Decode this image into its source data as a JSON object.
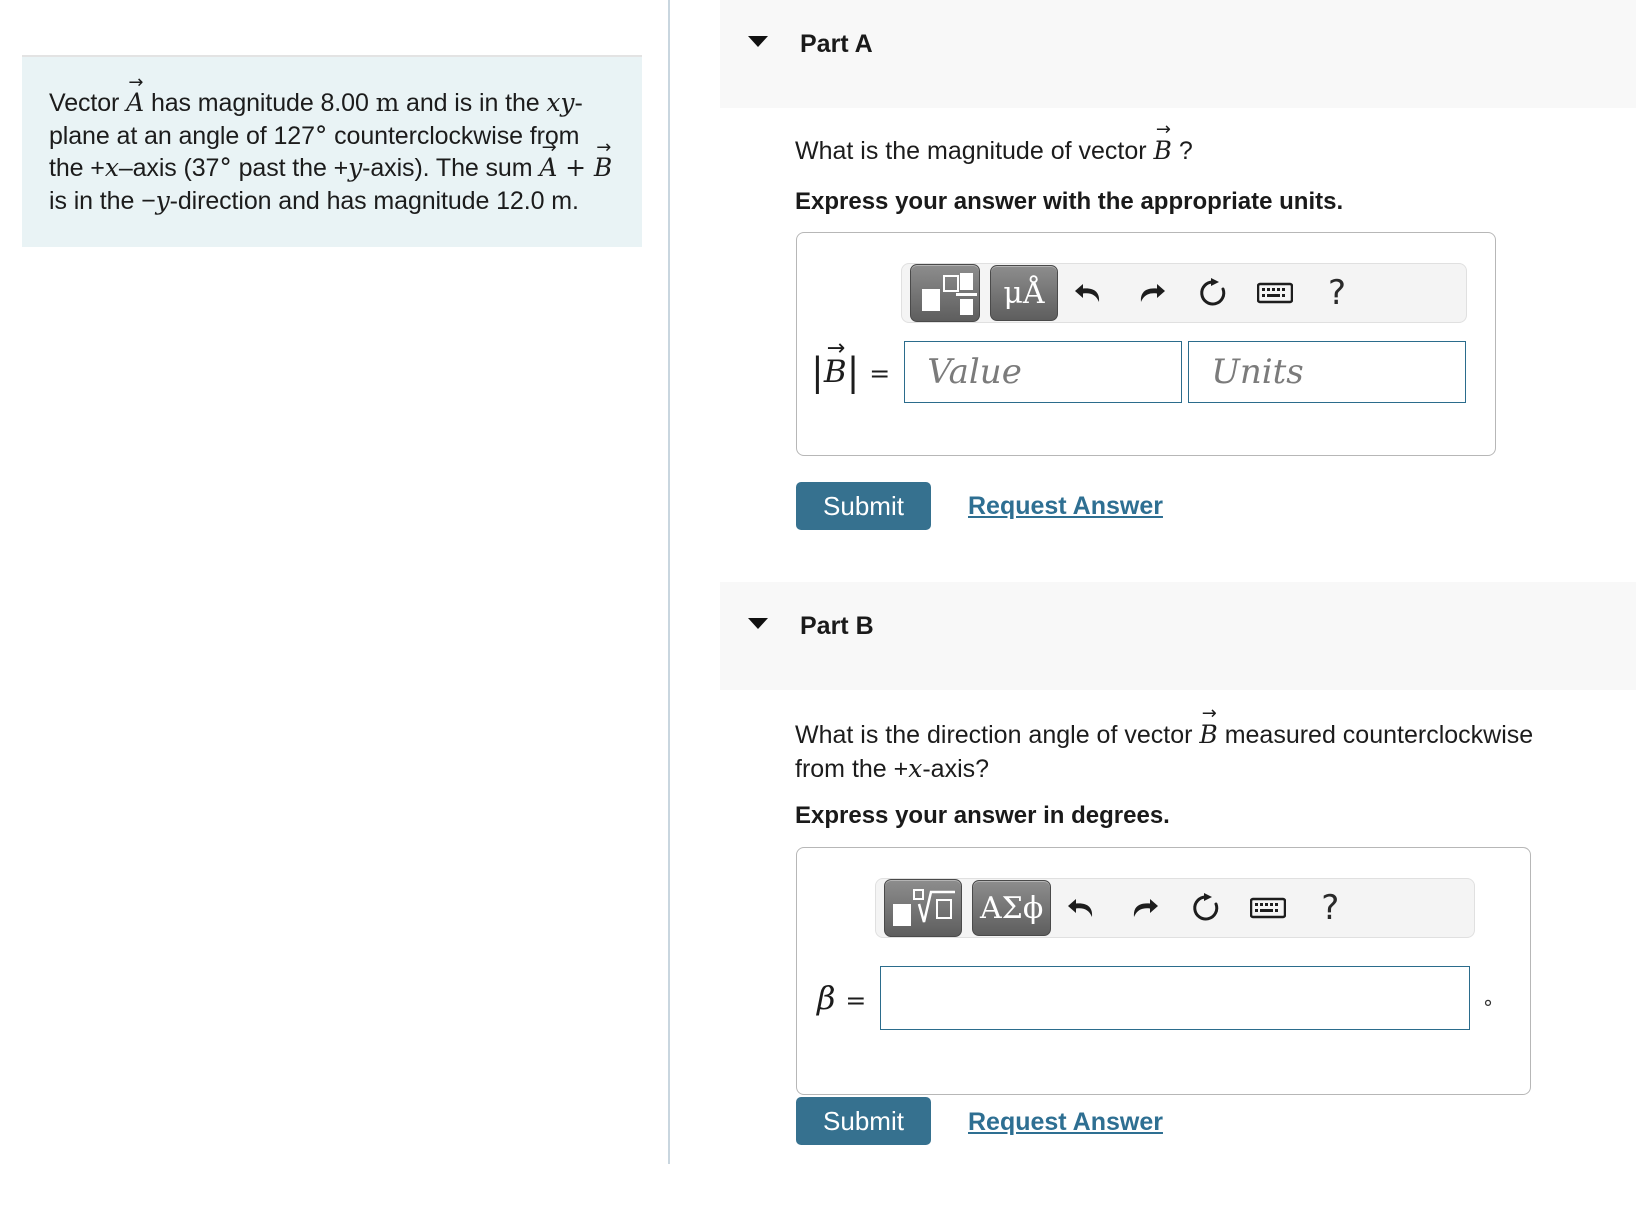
{
  "problem": {
    "line1_pre": "Vector ",
    "vec_a": "A",
    "line1_mid": " has magnitude 8.00 ",
    "unit_m": "m",
    "line1_post": " and is in the ",
    "xy": "xy",
    "line2_a": "-plane at an angle of 127",
    "deg": "°",
    "line2_b": " counterclockwise",
    "line3_a": "from the +",
    "x_sym": "x",
    "line3_b": "–axis (37",
    "line3_c": " past the +",
    "y_sym": "y",
    "line3_d": "-axis). The sum",
    "vec_b": "B",
    "line4_a": " is in the −",
    "line4_b": "-direction and has magnitude",
    "line5": "12.0 m."
  },
  "parts": [
    {
      "id": "part-a",
      "title": "Part A",
      "caret": "caret-down-icon",
      "question_pre": "What is the magnitude of vector ",
      "question_vec": "B",
      "question_post": " ?",
      "prompt": "Express your answer with the appropriate units.",
      "toolbar": {
        "template_button": "math-template-icon",
        "symbol_button": "μÅ",
        "undo": "undo-icon",
        "redo": "redo-icon",
        "reset": "reset-icon",
        "keyboard": "keyboard-icon",
        "help": "?"
      },
      "equation_label": "B",
      "equals": "=",
      "value_placeholder": "Value",
      "units_placeholder": "Units",
      "value_text": "",
      "units_text": "",
      "submit_label": "Submit",
      "request_label": "Request Answer"
    },
    {
      "id": "part-b",
      "title": "Part B",
      "caret": "caret-down-icon",
      "question_pre": "What is the direction angle of vector ",
      "question_vec": "B",
      "question_post": " measured counterclockwise",
      "question_line2_a": "from the +",
      "question_line2_x": "x",
      "question_line2_b": "-axis?",
      "prompt": "Express your answer in degrees.",
      "toolbar": {
        "template_button": "nth-root-template-icon",
        "symbol_button": "ΑΣϕ",
        "undo": "undo-icon",
        "redo": "redo-icon",
        "reset": "reset-icon",
        "keyboard": "keyboard-icon",
        "help": "?"
      },
      "equation_label": "β",
      "equals": "=",
      "answer_text": "",
      "unit_suffix": "°",
      "submit_label": "Submit",
      "request_label": "Request Answer"
    }
  ],
  "colors": {
    "problem_bg": "#e9f3f5",
    "header_bg": "#f8f8f8",
    "accent": "#36718f",
    "link": "#2e6f92",
    "field_border": "#2b6c8c",
    "divider": "#c9d6df"
  }
}
